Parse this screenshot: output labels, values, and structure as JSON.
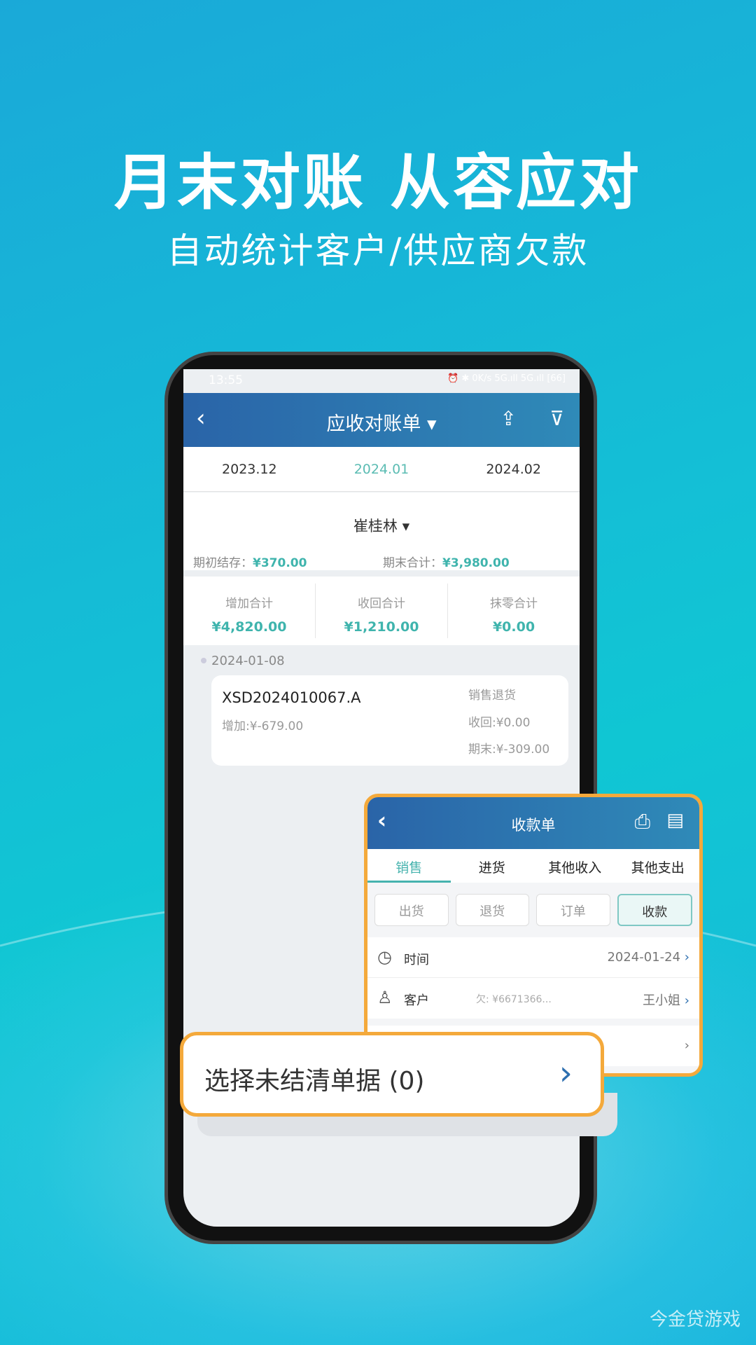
{
  "hero": {
    "title": "月末对账 从容应对",
    "subtitle": "自动统计客户/供应商欠款"
  },
  "status_bar": {
    "time": "13:55",
    "icons": "⏰ ✱ 0K/s 5G.ıll 5G.ıll [66]"
  },
  "statement": {
    "title": "应收对账单 ▾",
    "back": "‹",
    "share_icon": "⇪",
    "filter_icon": "⊽",
    "months": [
      "2023.12",
      "2024.01",
      "2024.02"
    ],
    "active_month": "2024.01",
    "customer": "崔桂林 ▾",
    "opening_label": "期初结存：",
    "opening_value": "¥370.00",
    "closing_label": "期末合计：",
    "closing_value": "¥3,980.00",
    "totals": [
      {
        "label": "增加合计",
        "value": "¥4,820.00"
      },
      {
        "label": "收回合计",
        "value": "¥1,210.00"
      },
      {
        "label": "抹零合计",
        "value": "¥0.00"
      }
    ],
    "entry": {
      "date": "2024-01-08",
      "number": "XSD2024010067.A",
      "type": "销售退货",
      "added": "增加:¥-679.00",
      "received": "收回:¥0.00",
      "ending": "期末:¥-309.00"
    }
  },
  "receipt": {
    "title": "收款单",
    "back": "‹",
    "tabs": [
      "销售",
      "进货",
      "其他收入",
      "其他支出"
    ],
    "active_tab": "销售",
    "buttons": [
      "出货",
      "退货",
      "订单",
      "收款"
    ],
    "active_button": "收款",
    "time_label": "时间",
    "time_value": "2024-01-24",
    "customer_label": "客户",
    "owed": "欠: ¥6671366...",
    "customer_value": "王小姐",
    "chevron": "›"
  },
  "callout": {
    "label": "选择未结清单据 (0)",
    "chevron": "›"
  },
  "watermark": "今金贷游戏",
  "colors": {
    "accent": "#46b3ae",
    "header": "#2a64a8",
    "highlight": "#f4a93b"
  }
}
